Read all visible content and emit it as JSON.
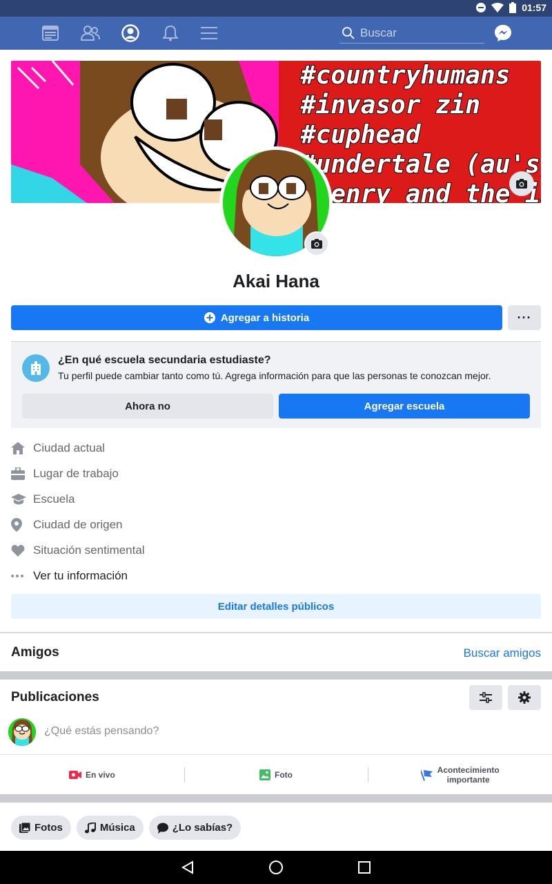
{
  "status_bar": {
    "time": "01:57"
  },
  "topbar": {
    "search_placeholder": "Buscar",
    "icons": [
      "news-feed-icon",
      "friends-icon",
      "profile-icon",
      "notifications-icon",
      "menu-icon",
      "messenger-icon"
    ]
  },
  "cover": {
    "tags": [
      "#countryhumans",
      "#invasor zin",
      "#cuphead",
      "#undertale (au's)",
      "#henry and the ink"
    ]
  },
  "profile": {
    "name": "Akai Hana",
    "story_button": "Agregar a historia",
    "more_button": "···"
  },
  "school_prompt": {
    "title": "¿En qué escuela secundaria estudiaste?",
    "subtitle": "Tu perfil puede cambiar tanto como tú. Agrega información para que las personas te conozcan mejor.",
    "dismiss_label": "Ahora no",
    "add_label": "Agregar escuela"
  },
  "info": {
    "items": [
      {
        "label": "Ciudad actual",
        "icon": "home-icon"
      },
      {
        "label": "Lugar de trabajo",
        "icon": "briefcase-icon"
      },
      {
        "label": "Escuela",
        "icon": "graduation-cap-icon"
      },
      {
        "label": "Ciudad de origen",
        "icon": "location-pin-icon"
      },
      {
        "label": "Situación sentimental",
        "icon": "heart-icon"
      },
      {
        "label": "Ver tu información",
        "icon": "more-dots-icon"
      }
    ],
    "edit_button": "Editar detalles públicos"
  },
  "friends": {
    "title": "Amigos",
    "find_link": "Buscar amigos"
  },
  "posts": {
    "title": "Publicaciones",
    "composer_placeholder": "¿Qué estás pensando?",
    "actions": [
      {
        "label": "En vivo",
        "icon": "live-video-icon",
        "color": "#f02849"
      },
      {
        "label": "Foto",
        "icon": "photo-icon",
        "color": "#45bd62"
      },
      {
        "label": "Acontecimiento importante",
        "icon": "flag-icon",
        "color": "#3578e5"
      }
    ]
  },
  "chips": [
    {
      "label": "Fotos",
      "icon": "photos-icon"
    },
    {
      "label": "Música",
      "icon": "music-note-icon"
    },
    {
      "label": "¿Lo sabías?",
      "icon": "speech-bubble-icon"
    }
  ],
  "colors": {
    "brand_blue": "#4267b2",
    "accent": "#1877f2",
    "status_bar": "#2d4373"
  }
}
